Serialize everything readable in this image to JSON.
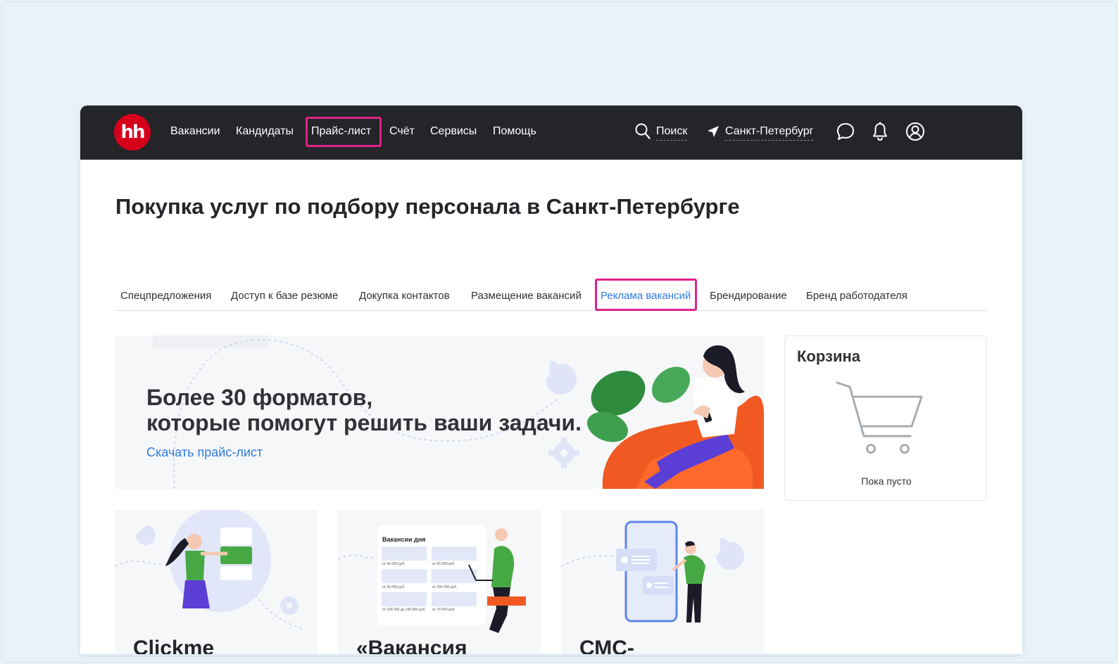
{
  "header": {
    "logo_text": "hh",
    "nav": [
      "Вакансии",
      "Кандидаты",
      "Прайс-лист",
      "Счёт",
      "Сервисы",
      "Помощь"
    ],
    "search_label": "Поиск",
    "city_label": "Санкт-Петербург",
    "colors": {
      "bar": "#232529",
      "logo": "#d6001c",
      "highlight": "#e0218a"
    }
  },
  "page": {
    "title": "Покупка услуг по подбору персонала в Санкт-Петербурге"
  },
  "tabs": {
    "items": [
      "Спецпредложения",
      "Доступ к базе резюме",
      "Докупка контактов",
      "Размещение вакансий",
      "Реклама вакансий",
      "Брендирование",
      "Бренд работодателя"
    ],
    "active": "Реклама вакансий",
    "active_color": "#2f7ce0"
  },
  "banner": {
    "line1": "Более 30 форматов,",
    "line2": "которые помогут решить ваши задачи.",
    "link": "Скачать прайс-лист"
  },
  "cart": {
    "title": "Корзина",
    "empty_text": "Пока пусто"
  },
  "cards": [
    {
      "title": "Clickme"
    },
    {
      "title": "«Вакансия",
      "mock_title": "Вакансии дня",
      "mock_rows": [
        [
          "от 45 000 руб.",
          "от 55 000 руб."
        ],
        [
          "от 50 000 руб.",
          "от 250 000 руб."
        ],
        [
          "от 100 000 до 150 000 руб.",
          "от 70 000 руб."
        ]
      ]
    },
    {
      "title": "СМС-"
    }
  ]
}
